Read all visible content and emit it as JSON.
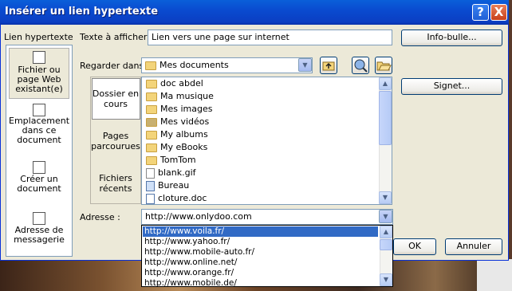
{
  "window": {
    "title": "Insérer un lien hypertexte"
  },
  "titlebar_buttons": {
    "help": "?",
    "close": "X"
  },
  "labels": {
    "lien_hypertexte": "Lien hypertexte",
    "texte_afficher": "Texte à afficher :",
    "regarder_dans": "Regarder dans :",
    "adresse": "Adresse :"
  },
  "fields": {
    "texte_value": "Lien vers une page sur internet",
    "regarder_value": "Mes documents",
    "adresse_value": "http://www.onlydoo.com"
  },
  "buttons": {
    "info_bulle": "Info-bulle...",
    "signet": "Signet...",
    "ok": "OK",
    "annuler": "Annuler"
  },
  "nav": [
    {
      "label": "Fichier ou page Web existant(e)",
      "icon": "web-page-icon",
      "selected": true
    },
    {
      "label": "Emplacement dans ce document",
      "icon": "document-location-icon",
      "selected": false
    },
    {
      "label": "Créer un document",
      "icon": "new-document-icon",
      "selected": false
    },
    {
      "label": "Adresse de messagerie",
      "icon": "email-icon",
      "selected": false
    }
  ],
  "midtabs": [
    {
      "label": "Dossier en cours",
      "selected": true
    },
    {
      "label": "Pages parcourues",
      "selected": false
    },
    {
      "label": "Fichiers récents",
      "selected": false
    }
  ],
  "files": [
    {
      "name": "doc abdel",
      "icon": "folder-icon"
    },
    {
      "name": "Ma musique",
      "icon": "music-folder-icon"
    },
    {
      "name": "Mes images",
      "icon": "pictures-folder-icon"
    },
    {
      "name": "Mes vidéos",
      "icon": "video-folder-icon"
    },
    {
      "name": "My albums",
      "icon": "folder-icon"
    },
    {
      "name": "My eBooks",
      "icon": "folder-icon"
    },
    {
      "name": "TomTom",
      "icon": "folder-icon"
    },
    {
      "name": "blank.gif",
      "icon": "gif-file-icon"
    },
    {
      "name": "Bureau",
      "icon": "shortcut-icon"
    },
    {
      "name": "cloture.doc",
      "icon": "word-doc-icon"
    }
  ],
  "dropdown": [
    {
      "url": "http://www.voila.fr/",
      "selected": true
    },
    {
      "url": "http://www.yahoo.fr/",
      "selected": false
    },
    {
      "url": "http://www.mobile-auto.fr/",
      "selected": false
    },
    {
      "url": "http://www.online.net/",
      "selected": false
    },
    {
      "url": "http://www.orange.fr/",
      "selected": false
    },
    {
      "url": "http://www.mobile.de/",
      "selected": false
    }
  ],
  "colors": {
    "titlebar": "#0a4bd0",
    "selection": "#316ac5",
    "dialog_bg": "#ece9d8"
  }
}
